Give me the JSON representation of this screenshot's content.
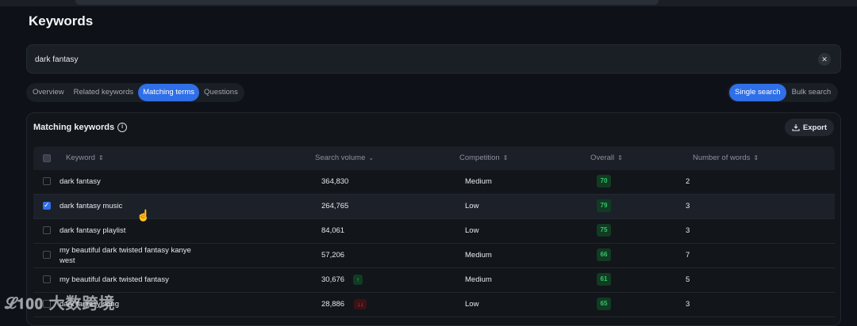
{
  "page": {
    "title": "Keywords"
  },
  "search": {
    "value": "dark fantasy",
    "clear_icon": "close-icon"
  },
  "tabs": [
    {
      "label": "Overview",
      "active": false
    },
    {
      "label": "Related keywords",
      "active": false
    },
    {
      "label": "Matching terms",
      "active": true
    },
    {
      "label": "Questions",
      "active": false
    }
  ],
  "mode": {
    "single": "Single search",
    "bulk": "Bulk search"
  },
  "card": {
    "title": "Matching keywords",
    "export_label": "Export"
  },
  "table": {
    "headers": {
      "keyword": "Keyword",
      "search_volume": "Search volume",
      "competition": "Competition",
      "overall": "Overall",
      "words": "Number of words"
    },
    "rows": [
      {
        "keyword": "dark fantasy",
        "volume": "364,830",
        "trend": "",
        "competition": "Medium",
        "overall": "70",
        "words": "2",
        "checked": false
      },
      {
        "keyword": "dark fantasy music",
        "volume": "264,765",
        "trend": "",
        "competition": "Low",
        "overall": "79",
        "words": "3",
        "checked": true
      },
      {
        "keyword": "dark fantasy playlist",
        "volume": "84,061",
        "trend": "",
        "competition": "Low",
        "overall": "75",
        "words": "3",
        "checked": false
      },
      {
        "keyword_line1": "my beautiful dark twisted fantasy kanye",
        "keyword_line2": "west",
        "volume": "57,206",
        "trend": "",
        "competition": "Medium",
        "overall": "66",
        "words": "7",
        "checked": false
      },
      {
        "keyword": "my beautiful dark twisted fantasy",
        "volume": "30,676",
        "trend": "↑",
        "competition": "Medium",
        "overall": "61",
        "words": "5",
        "checked": false
      },
      {
        "keyword": "dark fantasy song",
        "volume": "28,886",
        "trend": "↓↓",
        "competition": "Low",
        "overall": "65",
        "words": "3",
        "checked": false
      }
    ]
  },
  "watermark": "𝓛𝟭𝟬𝟬 大数跨境",
  "colors": {
    "accent": "#2f6fe8",
    "good": "#36c46a",
    "bad": "#e04b54",
    "background": "#0e1117"
  }
}
